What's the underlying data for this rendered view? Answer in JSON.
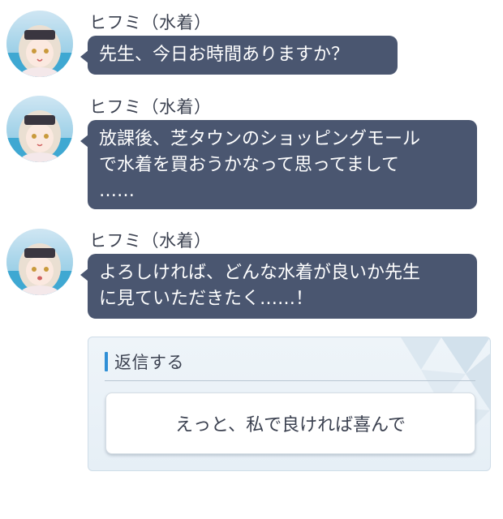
{
  "messages": [
    {
      "sender": "ヒフミ（水着）",
      "lines": [
        "先生、今日お時間ありますか？"
      ]
    },
    {
      "sender": "ヒフミ（水着）",
      "lines": [
        "放課後、芝タウンのショッピングモール",
        "で水着を買おうかなって思ってまして",
        "……"
      ]
    },
    {
      "sender": "ヒフミ（水着）",
      "lines": [
        "よろしければ、どんな水着が良いか先生",
        "に見ていただきたく……！"
      ]
    }
  ],
  "reply": {
    "title": "返信する",
    "options": [
      "えっと、私で良ければ喜んで"
    ]
  },
  "colors": {
    "bubble": "#4a5670",
    "accent": "#2f8fd6",
    "text": "#3b4150"
  }
}
